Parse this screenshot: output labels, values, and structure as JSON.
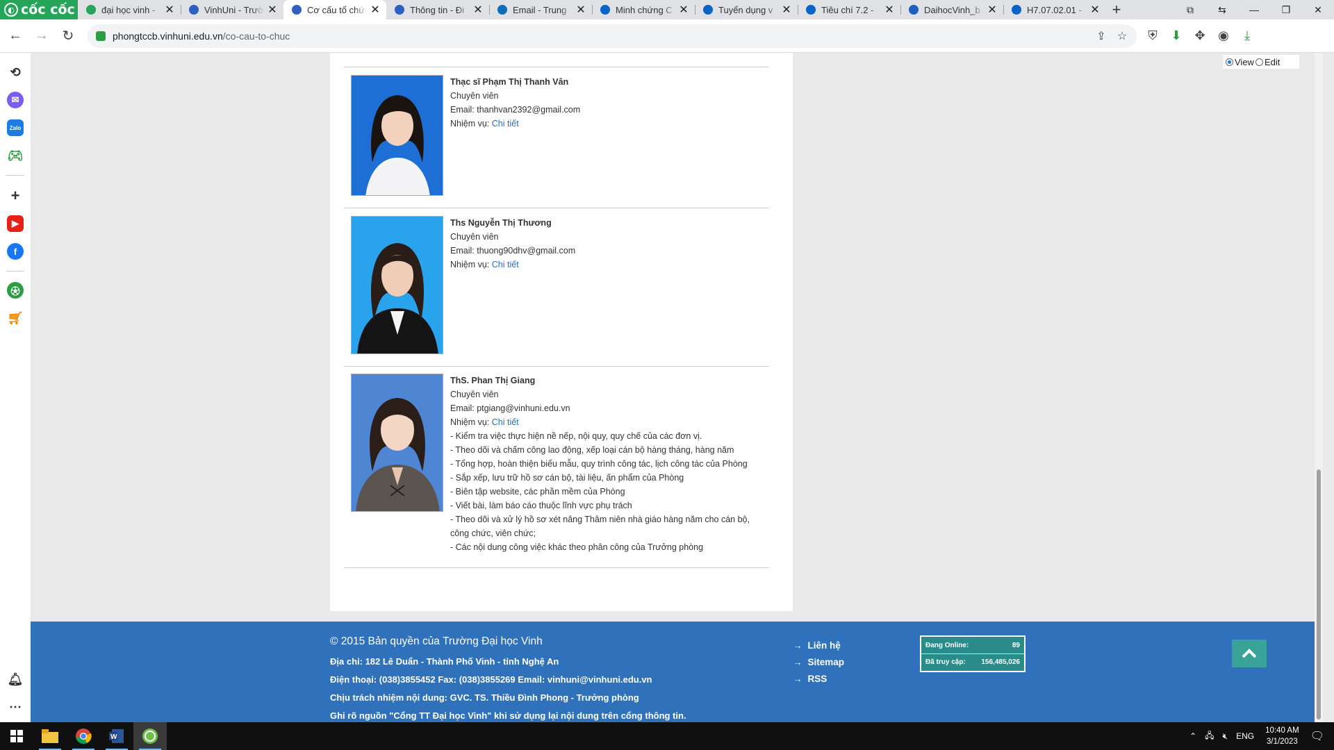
{
  "browser": {
    "logo_text": "cốc cốc",
    "tabs": [
      {
        "title": "đại học vinh -",
        "icon": "coccoc-icon",
        "color": "#25a55a"
      },
      {
        "title": "VinhUni - Trườ",
        "icon": "vinhuni-icon",
        "color": "#2f5fbf"
      },
      {
        "title": "Cơ cấu tổ chức",
        "icon": "vinhuni-icon",
        "color": "#2f5fbf",
        "active": true
      },
      {
        "title": "Thông tin - Đi",
        "icon": "vinhuni-icon",
        "color": "#2f5fbf"
      },
      {
        "title": "Email - Trung",
        "icon": "outlook-icon",
        "color": "#0f6cbd"
      },
      {
        "title": "Minh chứng C",
        "icon": "onedrive-icon",
        "color": "#0a64c8"
      },
      {
        "title": "Tuyển dụng v",
        "icon": "onedrive-icon",
        "color": "#0a64c8"
      },
      {
        "title": "Tiêu chí 7.2 -",
        "icon": "onedrive-icon",
        "color": "#0a64c8"
      },
      {
        "title": "DaihocVinh_b",
        "icon": "word-icon",
        "color": "#1d5fbf"
      },
      {
        "title": "H7.07.02.01 -",
        "icon": "onedrive-icon",
        "color": "#0a64c8"
      }
    ],
    "close_glyph": "✕",
    "new_tab_glyph": "+",
    "url_host": "phongtccb.vinhuni.edu.vn",
    "url_path": "/co-cau-to-chuc"
  },
  "view_edit": {
    "view": "View",
    "edit": "Edit"
  },
  "staff": [
    {
      "name": "Thạc sĩ Phạm Thị Thanh Vân",
      "role": "Chuyên viên",
      "email_label": "Email:",
      "email": "thanhvan2392@gmail.com",
      "duty_label": "Nhiệm vụ:",
      "detail_link": "Chi tiết",
      "duties": []
    },
    {
      "name": "Ths Nguyễn Thị Thương",
      "role": "Chuyên viên",
      "email_label": "Email:",
      "email": "thuong90dhv@gmail.com",
      "duty_label": "Nhiệm vụ:",
      "detail_link": "Chi tiết",
      "duties": []
    },
    {
      "name": "ThS. Phan Thị Giang",
      "role": "Chuyên viên",
      "email_label": "Email:",
      "email": "ptgiang@vinhuni.edu.vn",
      "duty_label": "Nhiệm vụ:",
      "detail_link": "Chi tiết",
      "duties": [
        "- Kiểm tra việc thực hiện nề nếp, nội quy, quy chế của các đơn vị.",
        "- Theo dõi và chấm công lao động, xếp loại cán bộ hàng tháng, hàng năm",
        "- Tổng hợp, hoàn thiện biểu mẫu, quy trình công tác, lịch công tác của Phòng",
        "- Sắp xếp, lưu trữ hồ sơ cán bộ, tài liệu, ấn phẩm của Phòng",
        "- Biên tập website, các phần mềm của Phòng",
        "- Viết bài, làm báo cáo thuộc lĩnh vực phụ trách",
        "- Theo dõi và xử lý hồ sơ xét nâng Thâm niên nhà giáo hàng năm cho cán bộ, công chức, viên chức;",
        "- Các nội dung công việc khác theo phân công của Trưởng phòng"
      ]
    }
  ],
  "footer": {
    "copyright": "© 2015 Bản quyền của Trường Đại học Vinh",
    "address": "Địa chỉ: 182 Lê Duẩn - Thành Phố Vinh - tỉnh Nghệ An",
    "phone": "Điện thoại: (038)3855452 Fax: (038)3855269 Email: vinhuni@vinhuni.edu.vn",
    "responsible": "Chịu trách nhiệm nội dung: GVC. TS. Thiều Đình Phong - Trưởng phòng",
    "source_note": "Ghi rõ nguồn \"Cổng TT Đại học Vinh\" khi sử dụng lại nội dung trên cổng thông tin.",
    "links": [
      "Liên hệ",
      "Sitemap",
      "RSS"
    ],
    "stats": {
      "online_label": "Đang Online:",
      "online_value": "89",
      "visits_label": "Đã truy cập:",
      "visits_value": "156,485,026"
    }
  },
  "taskbar": {
    "language": "ENG",
    "time": "10:40 AM",
    "date": "3/1/2023"
  }
}
